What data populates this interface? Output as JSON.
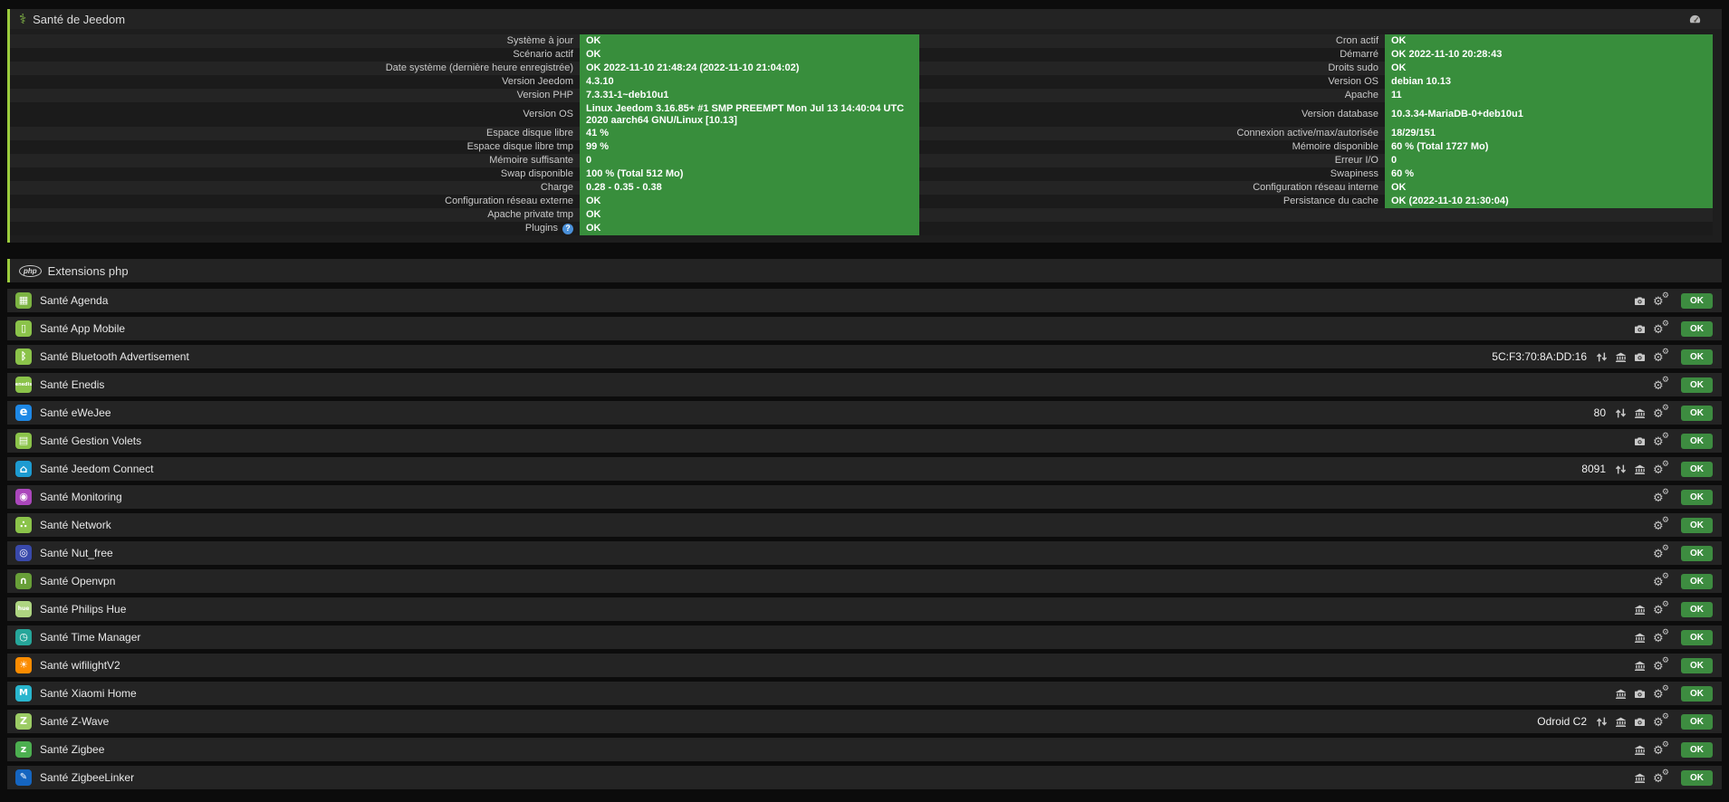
{
  "health": {
    "title": "Santé de Jeedom",
    "rows": [
      {
        "l1": "Système à jour",
        "v1": "OK",
        "l2": "Cron actif",
        "v2": "OK"
      },
      {
        "l1": "Scénario actif",
        "v1": "OK",
        "l2": "Démarré",
        "v2": "OK 2022-11-10 20:28:43"
      },
      {
        "l1": "Date système (dernière heure enregistrée)",
        "v1": "OK 2022-11-10 21:48:24 (2022-11-10 21:04:02)",
        "l2": "Droits sudo",
        "v2": "OK"
      },
      {
        "l1": "Version Jeedom",
        "v1": "4.3.10",
        "l2": "Version OS",
        "v2": "debian 10.13"
      },
      {
        "l1": "Version PHP",
        "v1": "7.3.31-1~deb10u1",
        "l2": "Apache",
        "v2": "11"
      },
      {
        "l1": "Version OS",
        "v1": "Linux Jeedom 3.16.85+ #1 SMP PREEMPT Mon Jul 13 14:40:04 UTC 2020 aarch64 GNU/Linux [10.13]",
        "l2": "Version database",
        "v2": "10.3.34-MariaDB-0+deb10u1"
      },
      {
        "l1": "Espace disque libre",
        "v1": "41 %",
        "l2": "Connexion active/max/autorisée",
        "v2": "18/29/151"
      },
      {
        "l1": "Espace disque libre tmp",
        "v1": "99 %",
        "l2": "Mémoire disponible",
        "v2": "60 % (Total 1727 Mo)"
      },
      {
        "l1": "Mémoire suffisante",
        "v1": "0",
        "l2": "Erreur I/O",
        "v2": "0"
      },
      {
        "l1": "Swap disponible",
        "v1": "100 % (Total 512 Mo)",
        "l2": "Swapiness",
        "v2": "60 %"
      },
      {
        "l1": "Charge",
        "v1": "0.28 - 0.35 - 0.38",
        "l2": "Configuration réseau interne",
        "v2": "OK"
      },
      {
        "l1": "Configuration réseau externe",
        "v1": "OK",
        "l2": "Persistance du cache",
        "v2": "OK (2022-11-10 21:30:04)"
      },
      {
        "l1": "Apache private tmp",
        "v1": "OK",
        "l2": "",
        "v2": ""
      },
      {
        "l1": "Plugins",
        "v1": "OK",
        "l2": "",
        "v2": "",
        "help": true
      }
    ]
  },
  "extensions": {
    "title": "Extensions php",
    "rows": [
      {
        "name": "Santé Agenda",
        "icon": {
          "name": "agenda-plugin-icon",
          "glyph": "▦",
          "bg": "#7cb342"
        },
        "extra": "",
        "actions": [
          "camera",
          "cogs"
        ],
        "status": "OK"
      },
      {
        "name": "Santé App Mobile",
        "icon": {
          "name": "app-mobile-plugin-icon",
          "glyph": "▯",
          "bg": "#8bc34a"
        },
        "extra": "",
        "actions": [
          "camera",
          "cogs"
        ],
        "status": "OK"
      },
      {
        "name": "Santé Bluetooth Advertisement",
        "icon": {
          "name": "bluetooth-advertisement-plugin-icon",
          "glyph": "ᛒ",
          "bg": "#8bc34a"
        },
        "extra": "5C:F3:70:8A:DD:16",
        "actions": [
          "updown",
          "bank",
          "camera",
          "cogs"
        ],
        "status": "OK"
      },
      {
        "name": "Santé Enedis",
        "icon": {
          "name": "enedis-plugin-icon",
          "glyph": "enedis",
          "bg": "#8bc34a",
          "fs": "5px"
        },
        "extra": "",
        "actions": [
          "cogs"
        ],
        "status": "OK"
      },
      {
        "name": "Santé eWeJee",
        "icon": {
          "name": "ewejee-plugin-icon",
          "glyph": "e",
          "bg": "#1e88e5",
          "fs": "13px"
        },
        "extra": "80",
        "actions": [
          "updown",
          "bank",
          "cogs"
        ],
        "status": "OK"
      },
      {
        "name": "Santé Gestion Volets",
        "icon": {
          "name": "gestion-volets-plugin-icon",
          "glyph": "▤",
          "bg": "#8bc34a"
        },
        "extra": "",
        "actions": [
          "camera",
          "cogs"
        ],
        "status": "OK"
      },
      {
        "name": "Santé Jeedom Connect",
        "icon": {
          "name": "jeedom-connect-plugin-icon",
          "glyph": "⌂",
          "bg": "#1d9bd1",
          "fs": "12px"
        },
        "extra": "8091",
        "actions": [
          "updown",
          "bank",
          "cogs"
        ],
        "status": "OK"
      },
      {
        "name": "Santé Monitoring",
        "icon": {
          "name": "monitoring-plugin-icon",
          "glyph": "◉",
          "bg": "#ab47bc"
        },
        "extra": "",
        "actions": [
          "cogs"
        ],
        "status": "OK"
      },
      {
        "name": "Santé Network",
        "icon": {
          "name": "network-plugin-icon",
          "glyph": "∴",
          "bg": "#8bc34a"
        },
        "extra": "",
        "actions": [
          "cogs"
        ],
        "status": "OK"
      },
      {
        "name": "Santé Nut_free",
        "icon": {
          "name": "nut-free-plugin-icon",
          "glyph": "◎",
          "bg": "#3949ab"
        },
        "extra": "",
        "actions": [
          "cogs"
        ],
        "status": "OK"
      },
      {
        "name": "Santé Openvpn",
        "icon": {
          "name": "openvpn-plugin-icon",
          "glyph": "∩",
          "bg": "#689f38"
        },
        "extra": "",
        "actions": [
          "cogs"
        ],
        "status": "OK"
      },
      {
        "name": "Santé Philips Hue",
        "icon": {
          "name": "philips-hue-plugin-icon",
          "glyph": "hue",
          "bg": "#aed581",
          "fs": "6px"
        },
        "extra": "",
        "actions": [
          "bank",
          "cogs"
        ],
        "status": "OK"
      },
      {
        "name": "Santé Time Manager",
        "icon": {
          "name": "time-manager-plugin-icon",
          "glyph": "◷",
          "bg": "#26a69a"
        },
        "extra": "",
        "actions": [
          "bank",
          "cogs"
        ],
        "status": "OK"
      },
      {
        "name": "Santé wifilightV2",
        "icon": {
          "name": "wifilightv2-plugin-icon",
          "glyph": "☀",
          "bg": "#fb8c00"
        },
        "extra": "",
        "actions": [
          "bank",
          "cogs"
        ],
        "status": "OK"
      },
      {
        "name": "Santé Xiaomi Home",
        "icon": {
          "name": "xiaomi-home-plugin-icon",
          "glyph": "M",
          "bg": "#29b6ce",
          "fs": "10px"
        },
        "extra": "",
        "actions": [
          "bank",
          "camera",
          "cogs"
        ],
        "status": "OK"
      },
      {
        "name": "Santé Z-Wave",
        "icon": {
          "name": "z-wave-plugin-icon",
          "glyph": "Z",
          "bg": "#9ccc65"
        },
        "extra": "Odroid C2",
        "actions": [
          "updown",
          "bank",
          "camera",
          "cogs"
        ],
        "status": "OK"
      },
      {
        "name": "Santé Zigbee",
        "icon": {
          "name": "zigbee-plugin-icon",
          "glyph": "z",
          "bg": "#4caf50"
        },
        "extra": "",
        "actions": [
          "bank",
          "cogs"
        ],
        "status": "OK"
      },
      {
        "name": "Santé ZigbeeLinker",
        "icon": {
          "name": "zigbeelinker-plugin-icon",
          "glyph": "✎",
          "bg": "#1565c0",
          "fs": "10px"
        },
        "extra": "",
        "actions": [
          "bank",
          "cogs"
        ],
        "status": "OK"
      }
    ]
  },
  "colors": {
    "panel_green_border": "#9ccc3d",
    "value_green": "#388e3c",
    "ok_badge_green": "#3d8c40",
    "help_blue": "#4a90d9",
    "title_icon_green": "#8bc34a"
  }
}
